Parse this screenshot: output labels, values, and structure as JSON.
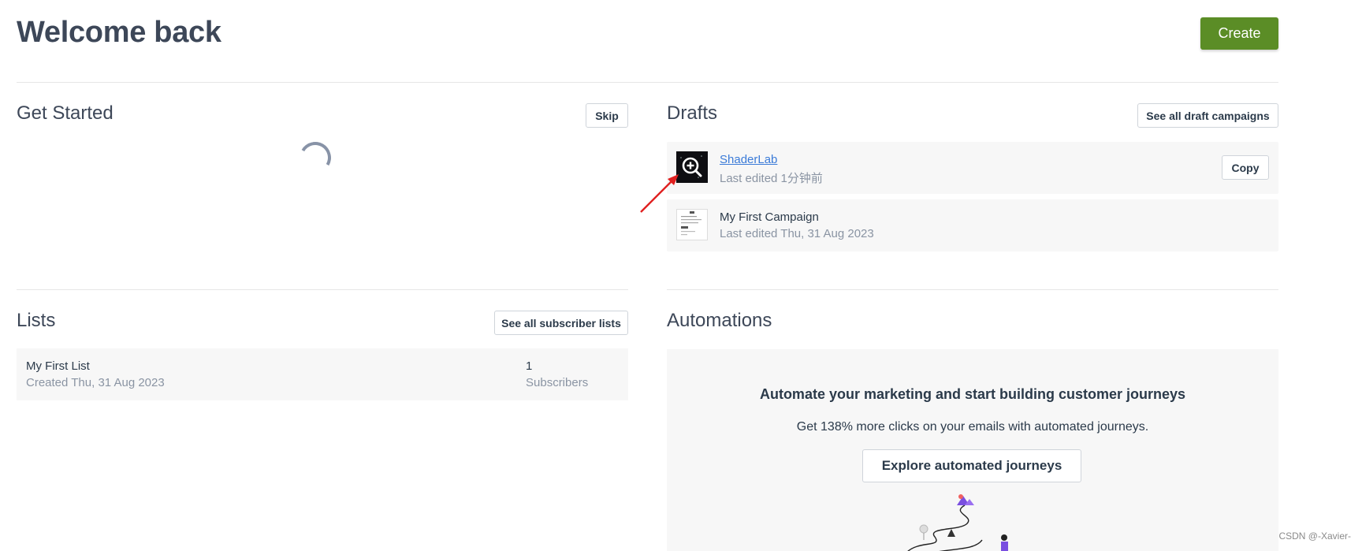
{
  "header": {
    "title": "Welcome back",
    "create_label": "Create"
  },
  "get_started": {
    "title": "Get Started",
    "skip_label": "Skip"
  },
  "drafts": {
    "title": "Drafts",
    "see_all_label": "See all draft campaigns",
    "items": [
      {
        "name": "ShaderLab",
        "subtitle": "Last edited 1分钟前",
        "action_label": "Copy",
        "thumbnail": "dark-preview-with-zoom-icon"
      },
      {
        "name": "My First Campaign",
        "subtitle": "Last edited Thu, 31 Aug 2023",
        "thumbnail": "light-email-preview"
      }
    ]
  },
  "lists": {
    "title": "Lists",
    "see_all_label": "See all subscriber lists",
    "items": [
      {
        "name": "My First List",
        "subtitle": "Created Thu, 31 Aug 2023",
        "count": "1",
        "count_label": "Subscribers"
      }
    ]
  },
  "automations": {
    "title": "Automations",
    "heading": "Automate your marketing and start building customer journeys",
    "description": "Get 138% more clicks on your emails with automated journeys.",
    "cta_label": "Explore automated journeys"
  },
  "watermark": "CSDN @-Xavier-",
  "colors": {
    "primary": "#5b8d26",
    "link": "#3b7bd8",
    "annotation_arrow": "#e02020"
  }
}
